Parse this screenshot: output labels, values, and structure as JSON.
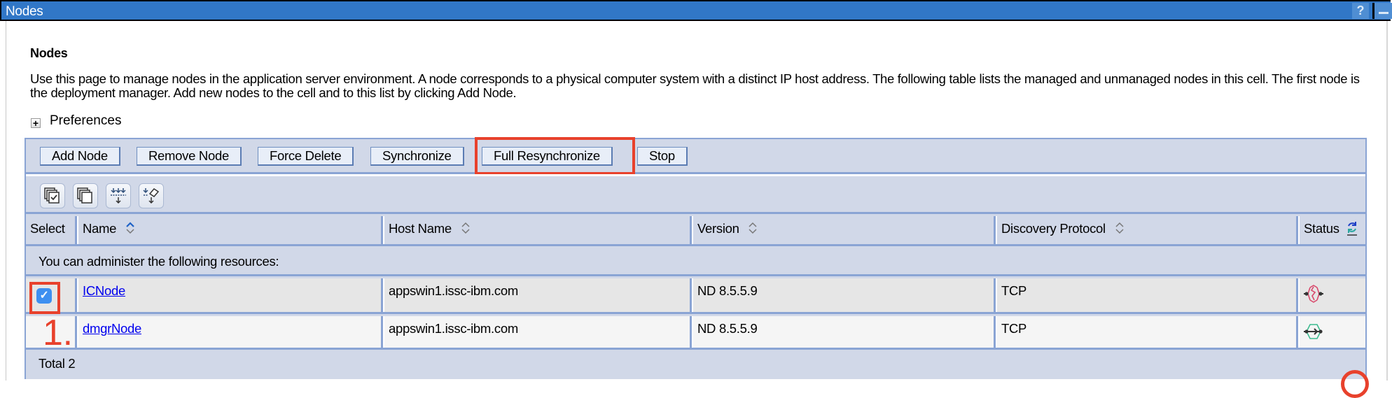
{
  "window": {
    "title": "Nodes",
    "help_label": "?",
    "minimize_label": "–"
  },
  "page": {
    "heading": "Nodes",
    "description": "Use this page to manage nodes in the application server environment. A node corresponds to a physical computer system with a distinct IP host address. The following table lists the managed and unmanaged nodes in this cell. The first node is the deployment manager. Add new nodes to the cell and to this list by clicking Add Node.",
    "preferences_label": "Preferences"
  },
  "toolbar": {
    "buttons": [
      {
        "label": "Add Node"
      },
      {
        "label": "Remove Node"
      },
      {
        "label": "Force Delete"
      },
      {
        "label": "Synchronize"
      },
      {
        "label": "Full Resynchronize"
      },
      {
        "label": "Stop"
      }
    ],
    "icons": [
      "select-all-icon",
      "deselect-all-icon",
      "filter-icon",
      "clear-filter-icon"
    ]
  },
  "table": {
    "columns": [
      {
        "label": "Select"
      },
      {
        "label": "Name"
      },
      {
        "label": "Host Name"
      },
      {
        "label": "Version"
      },
      {
        "label": "Discovery Protocol"
      },
      {
        "label": "Status"
      }
    ],
    "info_text": "You can administer the following resources:",
    "rows": [
      {
        "selected": true,
        "name": "ICNode",
        "host": "appswin1.issc-ibm.com",
        "version": "ND 8.5.5.9",
        "protocol": "TCP",
        "status": "not-synchronized"
      },
      {
        "selected": false,
        "name": "dmgrNode",
        "host": "appswin1.issc-ibm.com",
        "version": "ND 8.5.5.9",
        "protocol": "TCP",
        "status": "synchronized"
      }
    ],
    "total_label": "Total 2"
  },
  "annotations": {
    "step_1": "1.",
    "highlight_color": "#e8412c"
  },
  "colors": {
    "titlebar": "#3177c7",
    "table_header": "#d1d8e8",
    "table_border": "#8aa4d4",
    "link": "#0000ee",
    "status_down": "#d9486b",
    "status_up": "#3dbb8f"
  }
}
